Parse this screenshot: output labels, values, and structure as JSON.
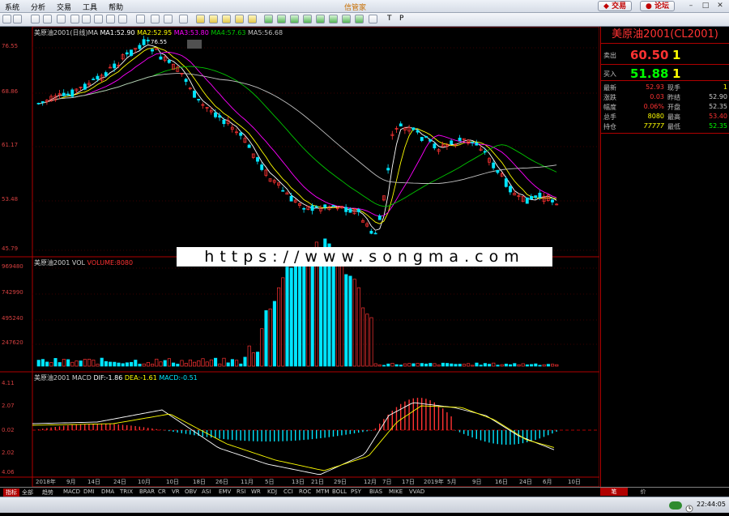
{
  "menu": [
    "系统",
    "分析",
    "交易",
    "工具",
    "帮助"
  ],
  "app_title": "信管家",
  "top_buttons": {
    "trade": "交易",
    "forum": "论坛"
  },
  "toolbar_text": [
    "T",
    "P"
  ],
  "price_axis": [
    "76.55",
    "68.86",
    "61.17",
    "53.48",
    "45.79"
  ],
  "vol_axis": [
    "969480",
    "742990",
    "495240",
    "247620"
  ],
  "macd_axis": [
    "4.11",
    "2.07",
    "0.02",
    "2.02",
    "4.06"
  ],
  "legend_price": {
    "name": "美原油2001(日线)",
    "ma_tag": "MA",
    "ma1": "MA1:52.90",
    "ma2": "MA2:52.95",
    "ma3": "MA3:53.80",
    "ma4": "MA4:57.63",
    "ma5": "MA5:56.68"
  },
  "legend_vol": {
    "name": "美原油2001 VOL",
    "volume": "VOLUME:8080"
  },
  "legend_macd": {
    "name": "美原油2001 MACD",
    "dif": "DIF:-1.86",
    "dea": "DEA:-1.61",
    "macd": "MACD:-0.51"
  },
  "peak_label": "76.55",
  "date_axis": [
    "2018年",
    "9月",
    "14日",
    "24日",
    "10月",
    "10日",
    "18日",
    "26日",
    "11月",
    "5日",
    "13日",
    "21日",
    "29日",
    "12月",
    "7日",
    "17日",
    "2019年",
    "5月",
    "9日",
    "16日",
    "24日",
    "6月",
    "10日"
  ],
  "indicators": [
    "指标",
    "全部",
    "趋势",
    "MACD",
    "DMI",
    "DMA",
    "TRIX",
    "BRAR",
    "CR",
    "VR",
    "OBV",
    "ASI",
    "EMV",
    "RSI",
    "WR",
    "KDJ",
    "CCI",
    "ROC",
    "MTM",
    "BOLL",
    "PSY",
    "BIAS",
    "MIKE",
    "VVAD"
  ],
  "quote": {
    "title": "美原油2001(CL2001)",
    "sell_label": "卖出",
    "sell_price": "60.50",
    "sell_qty": "1",
    "buy_label": "买入",
    "buy_price": "51.88",
    "buy_qty": "1",
    "rows": [
      {
        "l1": "最新",
        "v1": "52.93",
        "l2": "现手",
        "v2": "1"
      },
      {
        "l1": "涨跌",
        "v1": "0.03",
        "l2": "昨结",
        "v2": "52.90"
      },
      {
        "l1": "幅度",
        "v1": "0.06%",
        "l2": "开盘",
        "v2": "52.35"
      },
      {
        "l1": "总手",
        "v1": "8080",
        "l2": "最高",
        "v2": "53.40"
      },
      {
        "l1": "持仓",
        "v1": "77777",
        "l2": "最低",
        "v2": "52.35"
      }
    ]
  },
  "right_tabs": [
    "笔",
    "价"
  ],
  "status_time": "22:44:05",
  "watermark": "https://www.songma.com",
  "colors": {
    "up": "#ff3232",
    "down": "#00e5ff",
    "ma1": "#ffffff",
    "ma2": "#ffff00",
    "ma3": "#ff00ff",
    "ma4": "#00c800",
    "ma5": "#c0c0c0",
    "frame": "#b00000"
  }
}
